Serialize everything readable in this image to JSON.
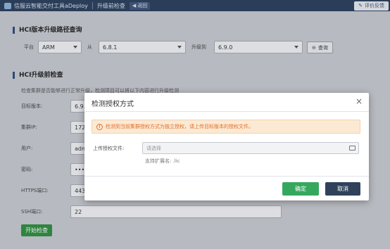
{
  "topbar": {
    "brand": "信服云智能交付工具aDeploy",
    "crumb": "升级前检查",
    "back_label": "返回",
    "right_label": "评价反馈"
  },
  "section1": {
    "title": "HCI版本升级路径查询",
    "platform_label": "平台",
    "platform_value": "ARM",
    "from_label": "从",
    "from_value": "6.8.1",
    "to_label": "升级到",
    "to_value": "6.9.0",
    "query_label": "查询"
  },
  "section2": {
    "title": "HCI升级前检查",
    "desc": "检查集群是否能够进行正常升级，检测项目可以将以下内容进行升级检测",
    "fields": [
      {
        "label": "目标版本:",
        "value": "6.9.0"
      },
      {
        "label": "集群IP:",
        "value": "172"
      },
      {
        "label": "用户:",
        "value": "adm"
      },
      {
        "label": "密码:",
        "value": "••••"
      },
      {
        "label": "HTTPS端口:",
        "value": "443"
      },
      {
        "label": "SSH端口:",
        "value": "22"
      }
    ],
    "start_label": "开始检查"
  },
  "modal": {
    "title": "检测授权方式",
    "close": "×",
    "alert_text": "检测到当前集群授权方式为独立授权，请上传目标版本的授权文件。",
    "file_label": "上传授权文件:",
    "file_placeholder": "请选择",
    "hint": "支持扩展名: .lic",
    "ok_label": "确定",
    "cancel_label": "取消"
  },
  "colors": {
    "topbar": "#2a3f5c",
    "ok": "#36a85e",
    "cancel": "#2f425a",
    "alert_text": "#e0702a",
    "start": "#2f8f3e"
  }
}
